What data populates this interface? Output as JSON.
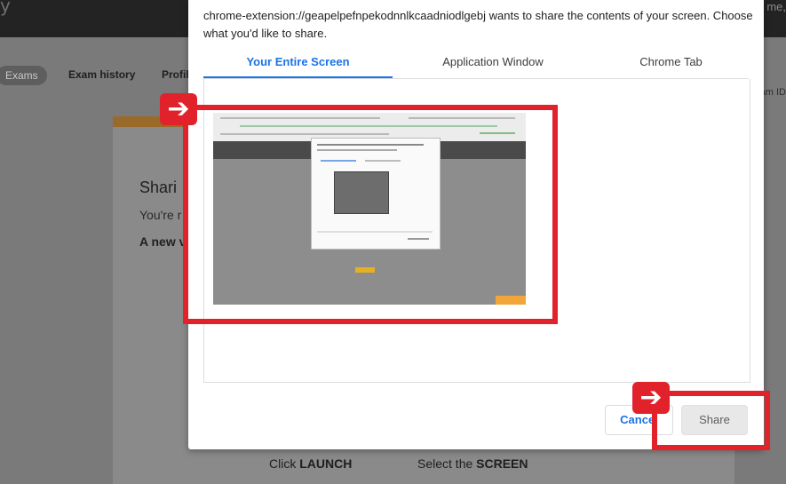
{
  "background": {
    "nav": {
      "pill": "Exams",
      "exam_history": "Exam history",
      "profile": "Profil",
      "exam_id": "am ID"
    },
    "top_right": "me,",
    "card": {
      "heading": "Shari",
      "subtext": "You're r",
      "bold_text": "A new v"
    },
    "bottom": {
      "launch_prefix": "Click ",
      "launch_bold": "LAUNCH",
      "screen_prefix": "Select the ",
      "screen_bold": "SCREEN"
    }
  },
  "dialog": {
    "message": "chrome-extension://geapelpefnpekodnnlkcaadniodlgebj wants to share the contents of your screen. Choose what you'd like to share.",
    "tabs": [
      {
        "label": "Your Entire Screen",
        "active": true
      },
      {
        "label": "Application Window",
        "active": false
      },
      {
        "label": "Chrome Tab",
        "active": false
      }
    ],
    "buttons": {
      "cancel": "Cancel",
      "share": "Share"
    }
  },
  "annotations": {
    "highlight_color": "#e1222b",
    "arrow_icon": "right-arrow-icon"
  }
}
